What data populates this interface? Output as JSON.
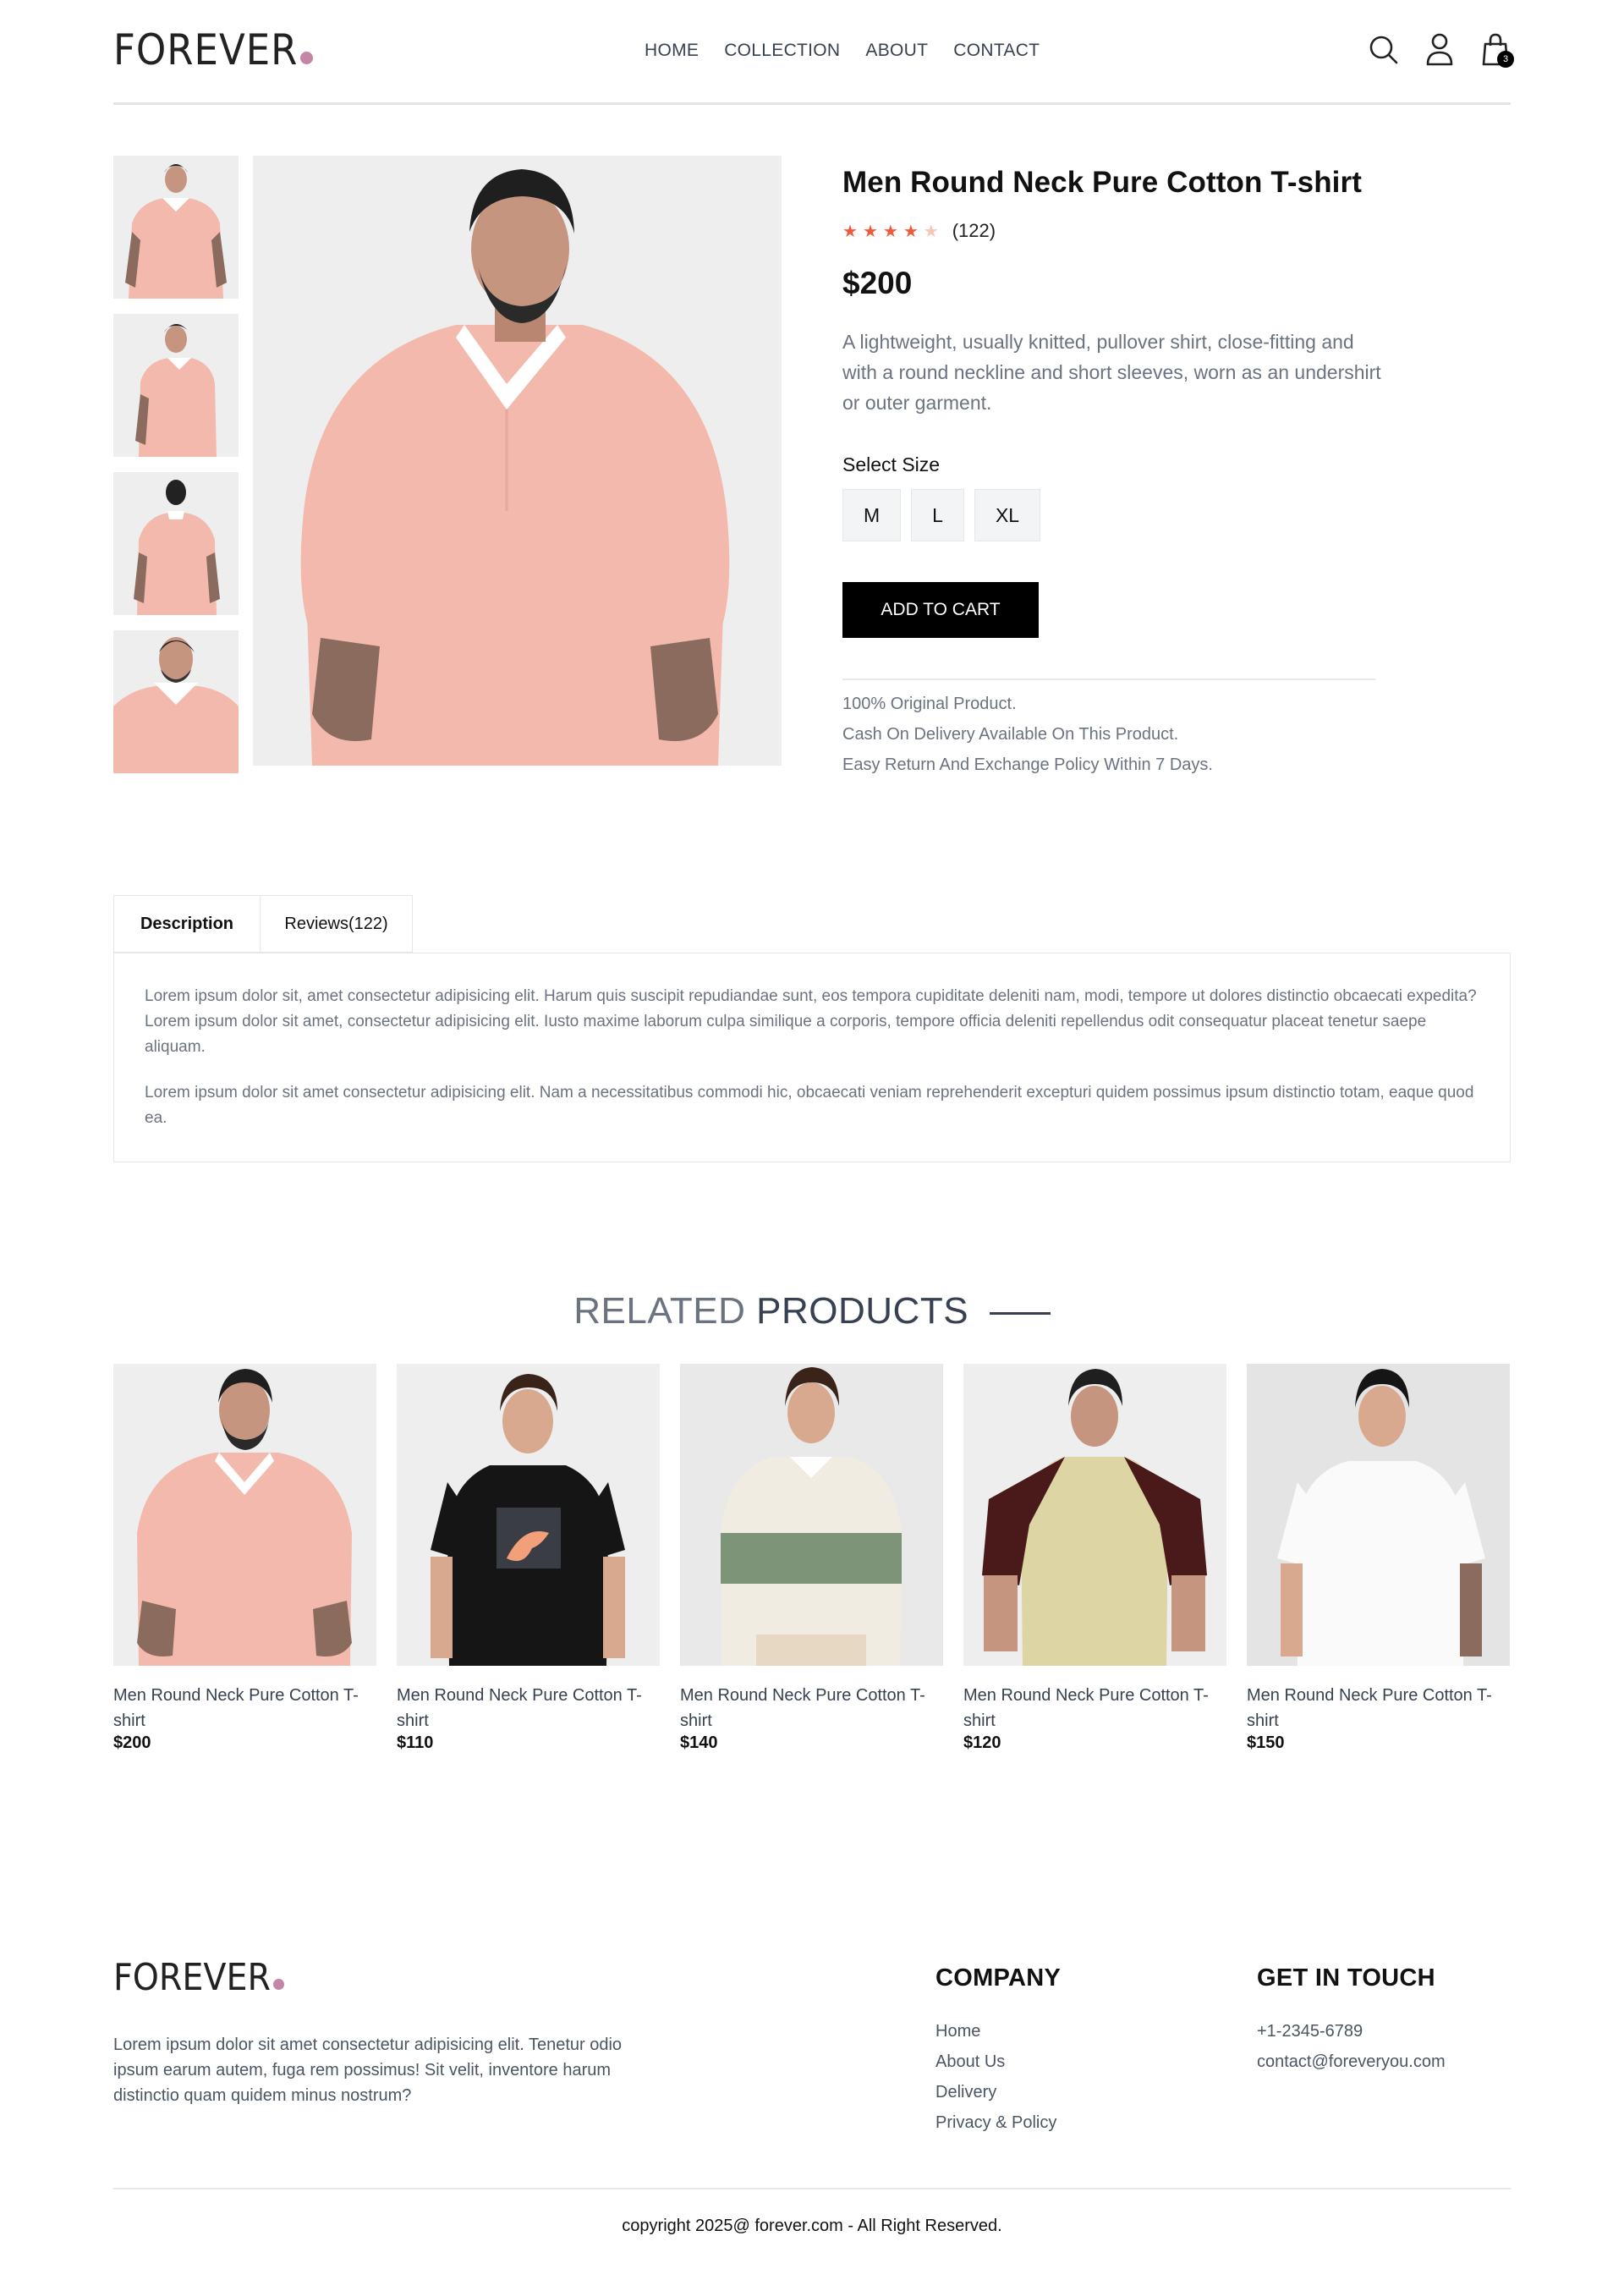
{
  "header": {
    "logo": "FOREVER",
    "nav": [
      "HOME",
      "COLLECTION",
      "ABOUT",
      "CONTACT"
    ],
    "cart_count": "3",
    "icons": [
      "search-icon",
      "user-icon",
      "cart-icon"
    ],
    "accent_color": "#c586a5"
  },
  "product": {
    "title": "Men Round Neck Pure Cotton T-shirt",
    "rating": 4,
    "rating_max": 5,
    "review_count": "(122)",
    "price": "$200",
    "description": "A lightweight, usually knitted, pullover shirt, close-fitting and with a round neckline and short sleeves, worn as an undershirt or outer garment.",
    "size_label": "Select Size",
    "sizes": [
      "M",
      "L",
      "XL"
    ],
    "add_to_cart": "ADD TO CART",
    "notes": [
      "100% Original Product.",
      "Cash On Delivery Available On This Product.",
      "Easy Return And Exchange Policy Within 7 Days."
    ],
    "star_color": "#f05a3c"
  },
  "tabs": {
    "description": "Description",
    "reviews": "Reviews(122)",
    "paragraphs": [
      "Lorem ipsum dolor sit, amet consectetur adipisicing elit. Harum quis suscipit repudiandae sunt, eos tempora cupiditate deleniti nam, modi, tempore ut dolores distinctio obcaecati expedita? Lorem ipsum dolor sit amet, consectetur adipisicing elit. Iusto maxime laborum culpa similique a corporis, tempore officia deleniti repellendus odit consequatur placeat tenetur saepe aliquam.",
      "Lorem ipsum dolor sit amet consectetur adipisicing elit. Nam a necessitatibus commodi hic, obcaecati veniam reprehenderit excepturi quidem possimus ipsum distinctio totam, eaque quod ea."
    ]
  },
  "related": {
    "title_a": "RELATED",
    "title_b": "PRODUCTS",
    "items": [
      {
        "name": "Men Round Neck Pure Cotton T-shirt",
        "price": "$200"
      },
      {
        "name": "Men Round Neck Pure Cotton T-shirt",
        "price": "$110"
      },
      {
        "name": "Men Round Neck Pure Cotton T-shirt",
        "price": "$140"
      },
      {
        "name": "Men Round Neck Pure Cotton T-shirt",
        "price": "$120"
      },
      {
        "name": "Men Round Neck Pure Cotton T-shirt",
        "price": "$150"
      }
    ]
  },
  "footer": {
    "logo": "FOREVER",
    "text": "Lorem ipsum dolor sit amet consectetur adipisicing elit. Tenetur odio ipsum earum autem, fuga rem possimus! Sit velit, inventore harum distinctio quam quidem minus nostrum?",
    "company_title": "COMPANY",
    "company_links": [
      "Home",
      "About Us",
      "Delivery",
      "Privacy & Policy"
    ],
    "contact_title": "GET IN TOUCH",
    "contact_lines": [
      "+1-2345-6789",
      "contact@foreveryou.com"
    ],
    "copyright": "copyright 2025@ forever.com - All Right Reserved."
  }
}
